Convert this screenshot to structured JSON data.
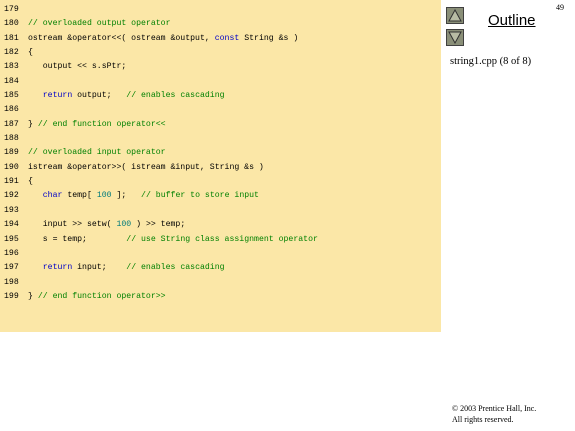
{
  "slide": {
    "page_number": "49",
    "outline_label": "Outline",
    "file_label": "string1.cpp (8 of 8)",
    "copyright_line1": "© 2003 Prentice Hall, Inc.",
    "copyright_line2": "All rights reserved."
  },
  "colors": {
    "panel_background": "#fbe7a7",
    "comment": "#008000",
    "keyword": "#0000c8",
    "number": "#007b7b",
    "nav_button": "#8a8f78"
  },
  "icons": {
    "up": "arrow-up-icon",
    "down": "arrow-down-icon"
  },
  "code": [
    {
      "num": "179",
      "tokens": []
    },
    {
      "num": "180",
      "tokens": [
        {
          "t": "// overloaded output operator",
          "k": "comment"
        }
      ]
    },
    {
      "num": "181",
      "tokens": [
        {
          "t": "ostream &operator<<( ostream &output, ",
          "k": "plain"
        },
        {
          "t": "const",
          "k": "keyword"
        },
        {
          "t": " String &s )",
          "k": "plain"
        }
      ]
    },
    {
      "num": "182",
      "tokens": [
        {
          "t": "{",
          "k": "plain"
        }
      ]
    },
    {
      "num": "183",
      "tokens": [
        {
          "t": "   output << s.sPtr;",
          "k": "plain"
        }
      ]
    },
    {
      "num": "184",
      "tokens": []
    },
    {
      "num": "185",
      "tokens": [
        {
          "t": "   ",
          "k": "plain"
        },
        {
          "t": "return",
          "k": "keyword"
        },
        {
          "t": " output;   ",
          "k": "plain"
        },
        {
          "t": "// enables cascading",
          "k": "comment"
        }
      ]
    },
    {
      "num": "186",
      "tokens": []
    },
    {
      "num": "187",
      "tokens": [
        {
          "t": "} ",
          "k": "plain"
        },
        {
          "t": "// end function operator<<",
          "k": "comment"
        }
      ]
    },
    {
      "num": "188",
      "tokens": []
    },
    {
      "num": "189",
      "tokens": [
        {
          "t": "// overloaded input operator",
          "k": "comment"
        }
      ]
    },
    {
      "num": "190",
      "tokens": [
        {
          "t": "istream &operator>>( istream &input, String &s )",
          "k": "plain"
        }
      ]
    },
    {
      "num": "191",
      "tokens": [
        {
          "t": "{",
          "k": "plain"
        }
      ]
    },
    {
      "num": "192",
      "tokens": [
        {
          "t": "   ",
          "k": "plain"
        },
        {
          "t": "char",
          "k": "keyword"
        },
        {
          "t": " temp[ ",
          "k": "plain"
        },
        {
          "t": "100",
          "k": "number"
        },
        {
          "t": " ];   ",
          "k": "plain"
        },
        {
          "t": "// buffer to store input",
          "k": "comment"
        }
      ]
    },
    {
      "num": "193",
      "tokens": []
    },
    {
      "num": "194",
      "tokens": [
        {
          "t": "   input >> setw( ",
          "k": "plain"
        },
        {
          "t": "100",
          "k": "number"
        },
        {
          "t": " ) >> temp;",
          "k": "plain"
        }
      ]
    },
    {
      "num": "195",
      "tokens": [
        {
          "t": "   s = temp;        ",
          "k": "plain"
        },
        {
          "t": "// use String class assignment operator",
          "k": "comment"
        }
      ]
    },
    {
      "num": "196",
      "tokens": []
    },
    {
      "num": "197",
      "tokens": [
        {
          "t": "   ",
          "k": "plain"
        },
        {
          "t": "return",
          "k": "keyword"
        },
        {
          "t": " input;    ",
          "k": "plain"
        },
        {
          "t": "// enables cascading",
          "k": "comment"
        }
      ]
    },
    {
      "num": "198",
      "tokens": []
    },
    {
      "num": "199",
      "tokens": [
        {
          "t": "} ",
          "k": "plain"
        },
        {
          "t": "// end function operator>>",
          "k": "comment"
        }
      ]
    }
  ]
}
